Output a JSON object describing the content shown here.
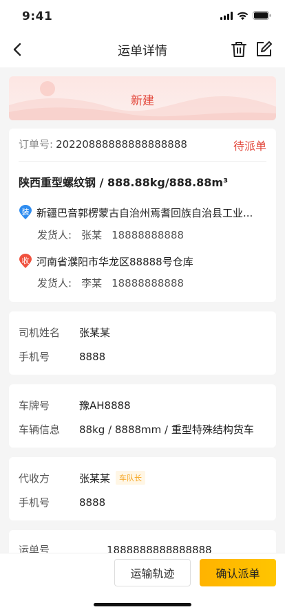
{
  "status_bar": {
    "time": "9:41"
  },
  "nav": {
    "title": "运单详情"
  },
  "banner": {
    "status": "新建"
  },
  "order": {
    "label": "订单号:",
    "number": "20220888888888888888",
    "status": "待派单",
    "goods": "陕西重型螺纹钢 / 888.88kg/888.88m³",
    "load": {
      "badge": "装",
      "address": "新疆巴音郭楞蒙古自治州焉耆回族自治县工业...",
      "contact_label": "发货人:",
      "contact_name": "张某",
      "contact_phone": "18888888888"
    },
    "unload": {
      "badge": "收",
      "address": "河南省濮阳市华龙区88888号仓库",
      "contact_label": "发货人:",
      "contact_name": "李某",
      "contact_phone": "18888888888"
    }
  },
  "driver": {
    "name_label": "司机姓名",
    "name": "张某某",
    "phone_label": "手机号",
    "phone": "8888"
  },
  "vehicle": {
    "plate_label": "车牌号",
    "plate": "豫AH8888",
    "info_label": "车辆信息",
    "info": "88kg / 8888mm / 重型特殊结构货车"
  },
  "payee": {
    "payee_label": "代收方",
    "payee": "张某某",
    "tag": "车队长",
    "phone_label": "手机号",
    "phone": "8888"
  },
  "waybill": {
    "label": "运单号",
    "number": "1888888888888888"
  },
  "actions": {
    "track": "运输轨迹",
    "confirm": "确认派单"
  },
  "colors": {
    "accent_red": "#e2473b",
    "primary_yellow": "#ffb300",
    "load_badge": "#2e8cf0",
    "unload_badge": "#f0523f"
  },
  "icons": {
    "back": "chevron-left-icon",
    "trash": "trash-icon",
    "edit": "edit-icon",
    "signal": "signal-icon",
    "wifi": "wifi-icon",
    "battery": "battery-icon"
  }
}
